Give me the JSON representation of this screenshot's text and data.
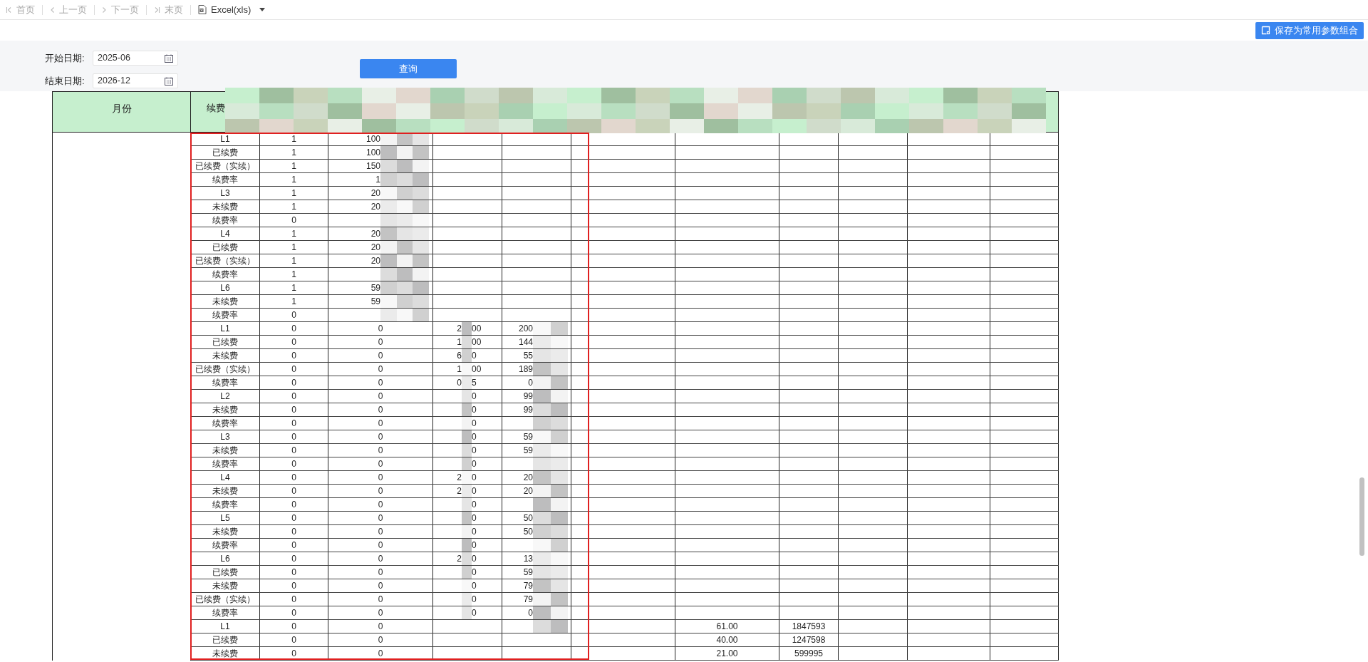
{
  "toolbar": [
    {
      "kind": "first",
      "label": "首页",
      "disabled": true
    },
    {
      "kind": "prev",
      "label": "上一页",
      "disabled": true
    },
    {
      "kind": "next",
      "label": "下一页",
      "disabled": true
    },
    {
      "kind": "last",
      "label": "末页",
      "disabled": true
    },
    {
      "kind": "export",
      "label": "Excel(xls)",
      "disabled": false
    }
  ],
  "save_button": "保存为常用参数组合",
  "params": [
    {
      "label": "开始日期:",
      "value": "2025-06"
    },
    {
      "label": "结束日期:",
      "value": "2026-12"
    }
  ],
  "query_button": "查询",
  "table": {
    "columns": [
      "月份",
      "续费"
    ],
    "rows": [
      {
        "label": "L1",
        "column_1": "1",
        "column_2": {
          "text": "100",
          "redacted": true
        }
      },
      {
        "label": "已续费",
        "column_1": "1",
        "column_2": {
          "text": "100",
          "redacted": true
        }
      },
      {
        "label": "已续费（实续）",
        "column_1": "1",
        "column_2": {
          "text": "150",
          "redacted": true
        }
      },
      {
        "label": "续费率",
        "column_1": "1",
        "column_2": {
          "text": "1",
          "redacted": true
        }
      },
      {
        "label": "L3",
        "column_1": "1",
        "column_2": {
          "text": "20",
          "redacted": true
        }
      },
      {
        "label": "未续费",
        "column_1": "1",
        "column_2": {
          "text": "20",
          "redacted": true
        }
      },
      {
        "label": "续费率",
        "column_1": "0",
        "column_2": {
          "redacted": true
        }
      },
      {
        "label": "L4",
        "column_1": "1",
        "column_2": {
          "text": "20",
          "redacted": true
        }
      },
      {
        "label": "已续费",
        "column_1": "1",
        "column_2": {
          "text": "20",
          "redacted": true
        }
      },
      {
        "label": "已续费（实续）",
        "column_1": "1",
        "column_2": {
          "text": "20",
          "redacted": true
        }
      },
      {
        "label": "续费率",
        "column_1": "1",
        "column_2": {
          "redacted": true
        }
      },
      {
        "label": "L6",
        "column_1": "1",
        "column_2": {
          "text": "59",
          "redacted": true
        }
      },
      {
        "label": "未续费",
        "column_1": "1",
        "column_2": {
          "text": "59",
          "redacted": true
        }
      },
      {
        "label": "续费率",
        "column_1": "0",
        "column_2": {
          "redacted": true
        }
      },
      {
        "label": "L1",
        "column_1": "0",
        "column_2": "0",
        "column_3": {
          "text": "2",
          "text_after": "00",
          "redacted": true
        },
        "column_4": {
          "text": "200",
          "redacted": true
        }
      },
      {
        "label": "已续费",
        "column_1": "0",
        "column_2": "0",
        "column_3": {
          "text": "1",
          "text_after": "00",
          "redacted": true
        },
        "column_4": {
          "text": "144",
          "redacted": true
        }
      },
      {
        "label": "未续费",
        "column_1": "0",
        "column_2": "0",
        "column_3": {
          "text": "6",
          "text_after": "0",
          "redacted": true
        },
        "column_4": {
          "text": "55",
          "redacted": true
        }
      },
      {
        "label": "已续费（实续）",
        "column_1": "0",
        "column_2": "0",
        "column_3": {
          "text": "1",
          "text_after": "00",
          "redacted": true
        },
        "column_4": {
          "text": "189",
          "redacted": true
        }
      },
      {
        "label": "续费率",
        "column_1": "0",
        "column_2": "0",
        "column_3": {
          "text": "0",
          "text_after": "5",
          "redacted": true
        },
        "column_4": {
          "text": "0",
          "redacted": true
        }
      },
      {
        "label": "L2",
        "column_1": "0",
        "column_2": "0",
        "column_3": {
          "text_after": "0",
          "redacted": true
        },
        "column_4": {
          "text": "99",
          "redacted": true
        }
      },
      {
        "label": "未续费",
        "column_1": "0",
        "column_2": "0",
        "column_3": {
          "text_after": "0",
          "redacted": true
        },
        "column_4": {
          "text": "99",
          "redacted": true
        }
      },
      {
        "label": "续费率",
        "column_1": "0",
        "column_2": "0",
        "column_3": {
          "text_after": "0",
          "redacted": true
        },
        "column_4": {
          "redacted": true
        }
      },
      {
        "label": "L3",
        "column_1": "0",
        "column_2": "0",
        "column_3": {
          "text_after": "0",
          "redacted": true
        },
        "column_4": {
          "text": "59",
          "redacted": true
        }
      },
      {
        "label": "未续费",
        "column_1": "0",
        "column_2": "0",
        "column_3": {
          "text_after": "0",
          "redacted": true
        },
        "column_4": {
          "text": "59",
          "redacted": true
        }
      },
      {
        "label": "续费率",
        "column_1": "0",
        "column_2": "0",
        "column_3": {
          "text_after": "0",
          "redacted": true
        },
        "column_4": {
          "redacted": true
        }
      },
      {
        "label": "L4",
        "column_1": "0",
        "column_2": "0",
        "column_3": {
          "text": "2",
          "text_after": "0",
          "redacted": true
        },
        "column_4": {
          "text": "20",
          "redacted": true
        }
      },
      {
        "label": "未续费",
        "column_1": "0",
        "column_2": "0",
        "column_3": {
          "text": "2",
          "text_after": "0",
          "redacted": true
        },
        "column_4": {
          "text": "20",
          "redacted": true
        }
      },
      {
        "label": "续费率",
        "column_1": "0",
        "column_2": "0",
        "column_3": {
          "text_after": "0",
          "redacted": true
        },
        "column_4": {
          "redacted": true
        }
      },
      {
        "label": "L5",
        "column_1": "0",
        "column_2": "0",
        "column_3": {
          "text_after": "0",
          "redacted": true
        },
        "column_4": {
          "text": "50",
          "redacted": true
        }
      },
      {
        "label": "未续费",
        "column_1": "0",
        "column_2": "0",
        "column_3": {
          "text_after": "0",
          "redacted": true
        },
        "column_4": {
          "text": "50",
          "redacted": true
        }
      },
      {
        "label": "续费率",
        "column_1": "0",
        "column_2": "0",
        "column_3": {
          "text_after": "0",
          "redacted": true
        },
        "column_4": {
          "redacted": true
        }
      },
      {
        "label": "L6",
        "column_1": "0",
        "column_2": "0",
        "column_3": {
          "text": "2",
          "text_after": "0",
          "redacted": true
        },
        "column_4": {
          "text": "13",
          "redacted": true
        }
      },
      {
        "label": "已续费",
        "column_1": "0",
        "column_2": "0",
        "column_3": {
          "text_after": "0",
          "redacted": true
        },
        "column_4": {
          "text": "59",
          "redacted": true
        }
      },
      {
        "label": "未续费",
        "column_1": "0",
        "column_2": "0",
        "column_3": {
          "text_after": "0",
          "redacted": true
        },
        "column_4": {
          "text": "79",
          "redacted": true
        }
      },
      {
        "label": "已续费（实续）",
        "column_1": "0",
        "column_2": "0",
        "column_3": {
          "text_after": "0",
          "redacted": true
        },
        "column_4": {
          "text": "79",
          "redacted": true
        }
      },
      {
        "label": "续费率",
        "column_1": "0",
        "column_2": "0",
        "column_3": {
          "text_after": "0",
          "redacted": true
        },
        "column_4": {
          "text": "0",
          "redacted": true
        }
      },
      {
        "label": "L1",
        "column_1": "0",
        "column_2": "0",
        "column_4": {
          "redacted": true
        },
        "column_6": "61.00",
        "column_7": "1847593"
      },
      {
        "label": "已续费",
        "column_1": "0",
        "column_2": "0",
        "column_6": "40.00",
        "column_7": "1247598"
      },
      {
        "label": "未续费",
        "column_1": "0",
        "column_2": "0",
        "column_6": "21.00",
        "column_7": "599995"
      }
    ]
  }
}
